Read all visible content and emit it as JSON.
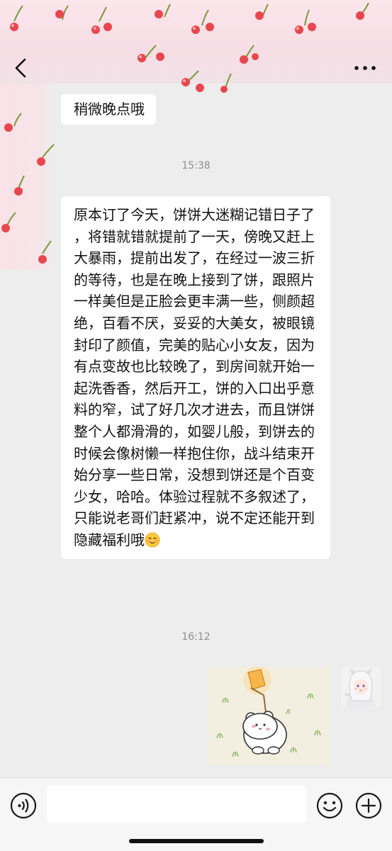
{
  "nav": {
    "back_icon": "chevron-left-icon",
    "more_icon": "more-dots-icon"
  },
  "messages": [
    {
      "sender": "other",
      "type": "text",
      "text": "稍微晚点哦"
    },
    {
      "type": "timestamp",
      "text": "15:38"
    },
    {
      "sender": "other",
      "type": "text",
      "text": "原本订了今天，饼饼大迷糊记错日子了，将错就错就提前了一天，傍晚又赶上大暴雨，提前出发了，在经过一波三折的等待，也是在晚上接到了饼，跟照片一样美但是正脸会更丰满一些，侧颜超绝，百看不厌，妥妥的大美女，被眼镜封印了颜值，完美的贴心小女友，因为有点变故也比较晚了，到房间就开始一起洗香香，然后开工，饼的入口出乎意料的窄，试了好几次才进去，而且饼饼整个人都滑滑的，如婴儿般，到饼去的时候会像树懒一样抱住你，战斗结束开始分享一些日常，没想到饼还是个百变少女，哈哈。体验过程就不多叙述了，只能说老哥们赶紧冲，说不定还能开到隐藏福利哦",
      "trailing_emoji": "blushing-face-emoji"
    },
    {
      "type": "timestamp",
      "text": "16:12"
    },
    {
      "sender": "self",
      "type": "sticker",
      "sticker_icon": "bear-with-lantern-sticker"
    }
  ],
  "input_bar": {
    "voice_icon": "voice-icon",
    "emoji_icon": "emoji-icon",
    "plus_icon": "plus-icon",
    "placeholder": ""
  },
  "colors": {
    "chat_background": "#ededed",
    "bubble_other": "#ffffff",
    "timestamp_text": "#8e8e8e",
    "wallpaper_pink": "#f7dde5",
    "cherry_red": "#e8474f"
  }
}
